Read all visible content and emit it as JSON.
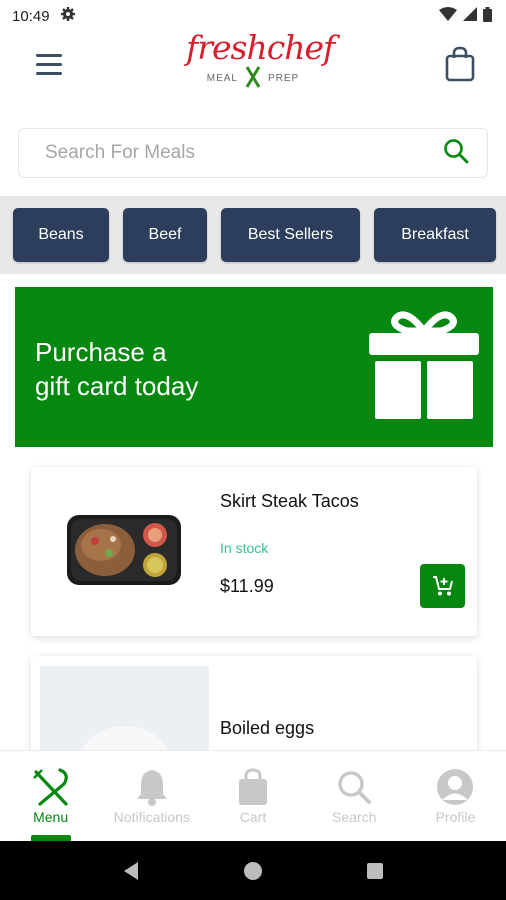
{
  "status_bar": {
    "time": "10:49"
  },
  "brand": {
    "logo_text": "freshchef",
    "tagline_left": "MEAL",
    "tagline_right": "PREP"
  },
  "search": {
    "placeholder": "Search For Meals"
  },
  "categories": [
    "Beans",
    "Beef",
    "Best Sellers",
    "Breakfast"
  ],
  "banner": {
    "line1": "Purchase a",
    "line2": "gift card today"
  },
  "products": [
    {
      "name": "Skirt Steak Tacos",
      "stock": "In stock",
      "price": "$11.99"
    },
    {
      "name": "Boiled eggs"
    }
  ],
  "bottom_nav": {
    "items": [
      {
        "label": "Menu",
        "icon": "utensils-icon",
        "active": true
      },
      {
        "label": "Notifications",
        "icon": "bell-icon",
        "active": false
      },
      {
        "label": "Cart",
        "icon": "shopping-bag-icon",
        "active": false
      },
      {
        "label": "Search",
        "icon": "search-icon",
        "active": false
      },
      {
        "label": "Profile",
        "icon": "user-icon",
        "active": false
      }
    ]
  },
  "colors": {
    "brand_green": "#06870f",
    "brand_red": "#d81e2c",
    "chip_navy": "#2c3e5c",
    "stock_green": "#3bbf8c"
  }
}
